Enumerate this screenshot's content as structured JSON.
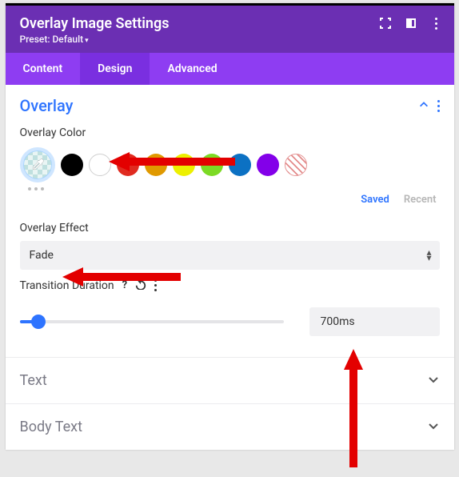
{
  "header": {
    "title": "Overlay Image Settings",
    "preset_label": "Preset: Default"
  },
  "tabs": {
    "content": "Content",
    "design": "Design",
    "advanced": "Advanced"
  },
  "overlay": {
    "section_title": "Overlay",
    "color_label": "Overlay Color",
    "saved": "Saved",
    "recent": "Recent",
    "effect_label": "Overlay Effect",
    "effect_value": "Fade",
    "duration_label": "Transition Duration",
    "duration_value": "700ms",
    "swatches": {
      "black": "#000000",
      "white": "#ffffff",
      "red": "#e02b20",
      "orange": "#e09900",
      "yellow": "#edf000",
      "green": "#7cda24",
      "blue": "#0c71c3",
      "purple": "#8300e9"
    }
  },
  "accordions": {
    "text": "Text",
    "body_text": "Body Text"
  }
}
